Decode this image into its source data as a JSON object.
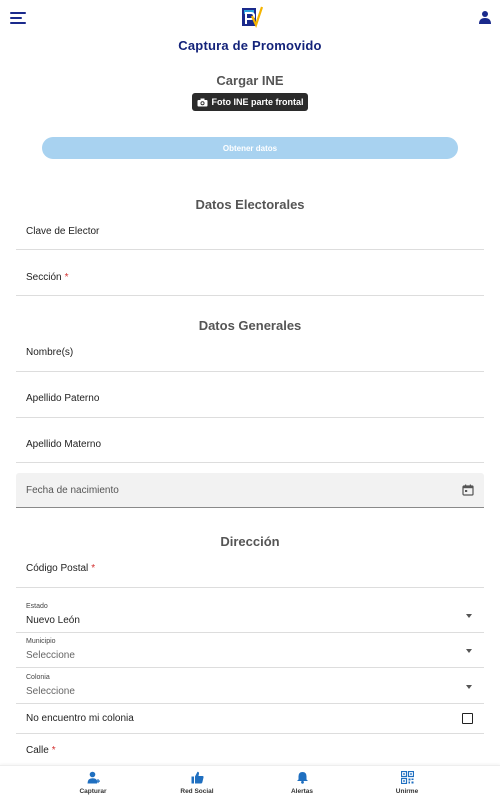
{
  "header": {
    "title": "Captura de Promovido"
  },
  "upload": {
    "title": "Cargar INE",
    "photo_button": "Foto INE parte frontal",
    "obtain_button": "Obtener datos"
  },
  "electoral": {
    "title": "Datos Electorales",
    "clave_label": "Clave de Elector",
    "seccion_label": "Sección"
  },
  "general": {
    "title": "Datos Generales",
    "nombre_label": "Nombre(s)",
    "paterno_label": "Apellido Paterno",
    "materno_label": "Apellido Materno",
    "fecha_label": "Fecha de nacimiento"
  },
  "address": {
    "title": "Dirección",
    "cp_label": "Código Postal",
    "estado_label": "Estado",
    "estado_value": "Nuevo León",
    "municipio_label": "Municipio",
    "municipio_value": "Seleccione",
    "colonia_label": "Colonia",
    "colonia_value": "Seleccione",
    "no_colonia_label": "No encuentro mi colonia",
    "calle_label": "Calle"
  },
  "required_mark": "*",
  "nav": {
    "items": [
      {
        "label": "Capturar",
        "icon": "person-add-icon"
      },
      {
        "label": "Red Social",
        "icon": "thumbs-up-icon"
      },
      {
        "label": "Alertas",
        "icon": "bell-icon"
      },
      {
        "label": "Unirme",
        "icon": "qr-code-icon"
      }
    ]
  },
  "colors": {
    "brand_navy": "#14237a",
    "accent_blue": "#1f6fc0",
    "button_light_blue": "#a8d2f0",
    "required_red": "#d32f2f"
  }
}
